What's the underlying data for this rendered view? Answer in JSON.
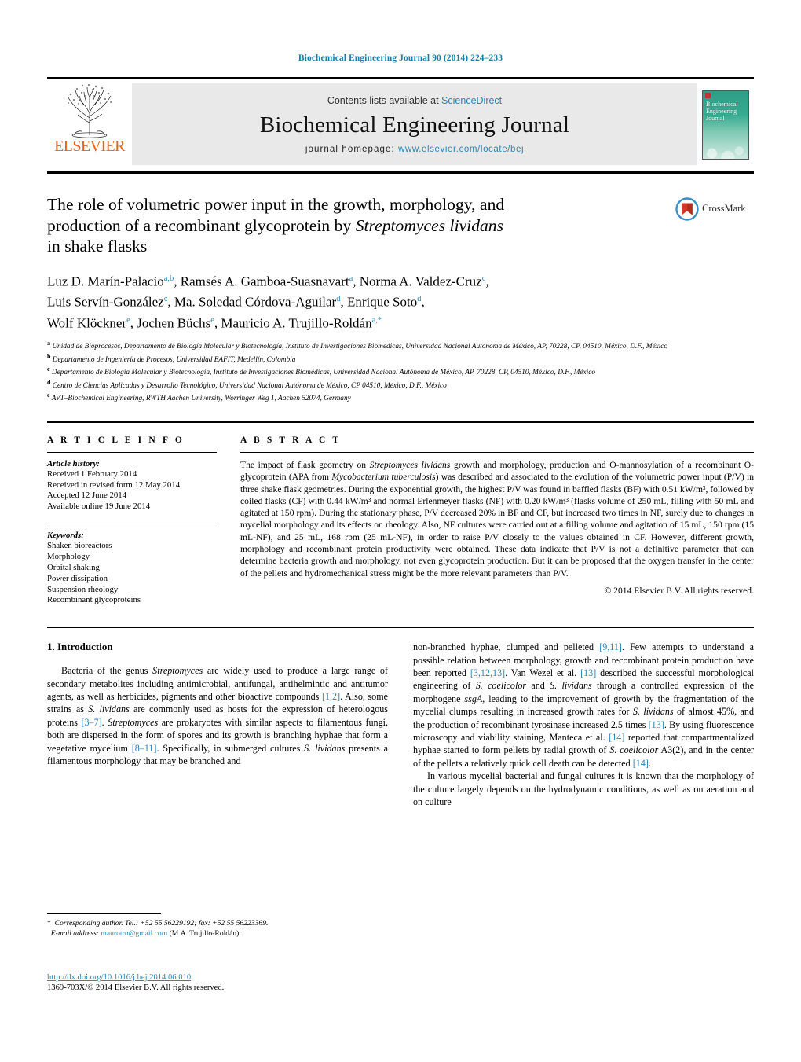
{
  "running_head": "Biochemical Engineering Journal 90 (2014) 224–233",
  "masthead": {
    "publisher_name": "ELSEVIER",
    "contents_prefix": "Contents lists available at ",
    "contents_link": "ScienceDirect",
    "journal_name": "Biochemical Engineering Journal",
    "homepage_label": "journal homepage:",
    "homepage_url": "www.elsevier.com/locate/bej",
    "cover_title": "Biochemical Engineering Journal"
  },
  "article": {
    "title_line1": "The role of volumetric power input in the growth, morphology, and",
    "title_line2_a": "production of a recombinant glycoprotein by ",
    "title_line2_italic": "Streptomyces lividans",
    "title_line3": "in shake flasks",
    "crossmark_label": "CrossMark",
    "authors_line1": "Luz D. Marín-Palacio a,b, Ramsés A. Gamboa-Suasnavart a, Norma A. Valdez-Cruz c,",
    "authors_line2": "Luis Servín-González c, Ma. Soledad Córdova-Aguilar d, Enrique Soto d,",
    "authors_line3": "Wolf Klöckner e, Jochen Büchs e, Mauricio A. Trujillo-Roldán a,*",
    "affiliations": [
      {
        "mark": "a",
        "text": "Unidad de Bioprocesos, Departamento de Biología Molecular y Biotecnología, Instituto de Investigaciones Biomédicas, Universidad Nacional Autónoma de México, AP, 70228, CP, 04510, México, D.F., México"
      },
      {
        "mark": "b",
        "text": "Departamento de Ingeniería de Procesos, Universidad EAFIT, Medellín, Colombia"
      },
      {
        "mark": "c",
        "text": "Departamento de Biología Molecular y Biotecnología, Instituto de Investigaciones Biomédicas, Universidad Nacional Autónoma de México, AP, 70228, CP, 04510, México, D.F., México"
      },
      {
        "mark": "d",
        "text": "Centro de Ciencias Aplicadas y Desarrollo Tecnológico, Universidad Nacional Autónoma de México, CP 04510, México, D.F., México"
      },
      {
        "mark": "e",
        "text": "AVT–Biochemical Engineering, RWTH Aachen University, Worringer Weg 1, Aachen 52074, Germany"
      }
    ]
  },
  "article_info": {
    "heading": "A R T I C L E   I N F O",
    "history_label": "Article history:",
    "history": [
      "Received 1 February 2014",
      "Received in revised form 12 May 2014",
      "Accepted 12 June 2014",
      "Available online 19 June 2014"
    ],
    "keywords_label": "Keywords:",
    "keywords": [
      "Shaken bioreactors",
      "Morphology",
      "Orbital shaking",
      "Power dissipation",
      "Suspension rheology",
      "Recombinant glycoproteins"
    ]
  },
  "abstract": {
    "heading": "A B S T R A C T",
    "p1_a": "The impact of flask geometry on ",
    "p1_i1": "Streptomyces lividans",
    "p1_b": " growth and morphology, production and O-mannosylation of a recombinant O-glycoprotein (APA from ",
    "p1_i2": "Mycobacterium tuberculosis",
    "p1_c": ") was described and associated to the evolution of the volumetric power input (P/V) in three shake flask geometries. During the exponential growth, the highest P/V was found in baffled flasks (BF) with 0.51 kW/m³, followed by coiled flasks (CF) with 0.44 kW/m³ and normal Erlenmeyer flasks (NF) with 0.20 kW/m³ (flasks volume of 250 mL, filling with 50 mL and agitated at 150 rpm). During the stationary phase, P/V decreased 20% in BF and CF, but increased two times in NF, surely due to changes in mycelial morphology and its effects on rheology. Also, NF cultures were carried out at a filling volume and agitation of 15 mL, 150 rpm (15 mL-NF), and 25 mL, 168 rpm (25 mL-NF), in order to raise P/V closely to the values obtained in CF. However, different growth, morphology and recombinant protein productivity were obtained. These data indicate that P/V is not a definitive parameter that can determine bacteria growth and morphology, not even glycoprotein production. But it can be proposed that the oxygen transfer in the center of the pellets and hydromechanical stress might be the more relevant parameters than P/V.",
    "copyright": "© 2014 Elsevier B.V. All rights reserved."
  },
  "introduction": {
    "heading": "1.  Introduction",
    "left_p1_a": "Bacteria of the genus ",
    "left_p1_i1": "Streptomyces",
    "left_p1_b": " are widely used to produce a large range of secondary metabolites including antimicrobial, antifungal, antihelmintic and antitumor agents, as well as herbicides, pigments and other bioactive compounds ",
    "left_p1_r1": "[1,2]",
    "left_p1_c": ". Also, some strains as ",
    "left_p1_i2": "S. lividans",
    "left_p1_d": " are commonly used as hosts for the expression of heterologous proteins ",
    "left_p1_r2": "[3–7]",
    "left_p1_e": ". ",
    "left_p1_i3": "Streptomyces",
    "left_p1_f": " are prokaryotes with similar aspects to filamentous fungi, both are dispersed in the form of spores and its growth is branching hyphae that form a vegetative mycelium ",
    "left_p1_r3": "[8–11]",
    "left_p1_g": ". Specifically, in submerged cultures ",
    "left_p1_i4": "S. lividans",
    "left_p1_h": " presents a filamentous morphology that may be branched and",
    "right_p1_cont": "non-branched hyphae, clumped and pelleted ",
    "right_p1_r1": "[9,11]",
    "right_p1_a": ". Few attempts to understand a possible relation between morphology, growth and recombinant protein production have been reported ",
    "right_p1_r2": "[3,12,13]",
    "right_p1_b": ". Van Wezel et al. ",
    "right_p1_r3": "[13]",
    "right_p1_c": " described the successful morphological engineering of ",
    "right_p1_i1": "S. coelicolor",
    "right_p1_d": " and ",
    "right_p1_i2": "S. lividans",
    "right_p1_e": " through a controlled expression of the morphogene ",
    "right_p1_i3": "ssgA",
    "right_p1_f": ", leading to the improvement of growth by the fragmentation of the mycelial clumps resulting in increased growth rates for ",
    "right_p1_i4": "S. lividans",
    "right_p1_g": " of almost 45%, and the production of recombinant tyrosinase increased 2.5 times ",
    "right_p1_r4": "[13]",
    "right_p1_h": ". By using fluorescence microscopy and viability staining, Manteca et al. ",
    "right_p1_r5": "[14]",
    "right_p1_i": " reported that compartmentalized hyphae started to form pellets by radial growth of ",
    "right_p1_i5": "S. coelicolor",
    "right_p1_j": " A3(2), and in the center of the pellets a relatively quick cell death can be detected ",
    "right_p1_r6": "[14]",
    "right_p1_k": ".",
    "right_p2": "In various mycelial bacterial and fungal cultures it is known that the morphology of the culture largely depends on the hydrodynamic conditions, as well as on aeration and on culture"
  },
  "footer": {
    "corresponding_mark": "*",
    "corresponding_text": "Corresponding author. Tel.: +52 55 56229192; fax: +52 55 56223369.",
    "email_label": "E-mail address:",
    "email": "maurotru@gmail.com",
    "email_suffix": "(M.A. Trujillo-Roldán).",
    "doi": "http://dx.doi.org/10.1016/j.bej.2014.06.010",
    "issn": "1369-703X/© 2014 Elsevier B.V. All rights reserved."
  },
  "colors": {
    "link": "#2b86b5",
    "elsevier_orange": "#E8601C",
    "runhead": "#1a7fa8"
  }
}
